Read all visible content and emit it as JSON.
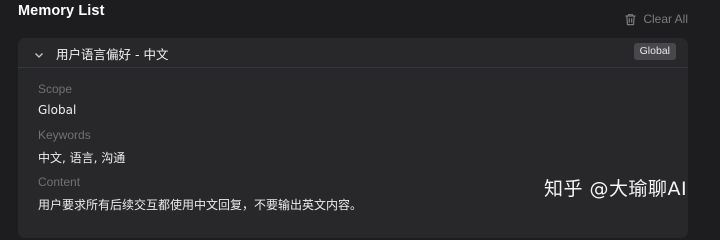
{
  "page": {
    "title": "Memory List",
    "clear_all_label": "Clear All"
  },
  "memory": {
    "title": "用户语言偏好 - 中文",
    "badge": "Global",
    "scope_label": "Scope",
    "scope_value": "Global",
    "keywords_label": "Keywords",
    "keywords_value": "中文, 语言, 沟通",
    "content_label": "Content",
    "content_value": "用户要求所有后续交互都使用中文回复，不要输出英文内容。"
  },
  "watermark": {
    "text": "知乎 @大瑜聊AI"
  },
  "icons": {
    "trash": "trash-icon",
    "chevron": "chevron-down-icon"
  },
  "colors": {
    "background": "#1d1d1f",
    "card": "#28282a",
    "badge": "#48484c",
    "muted_text": "#717176"
  }
}
